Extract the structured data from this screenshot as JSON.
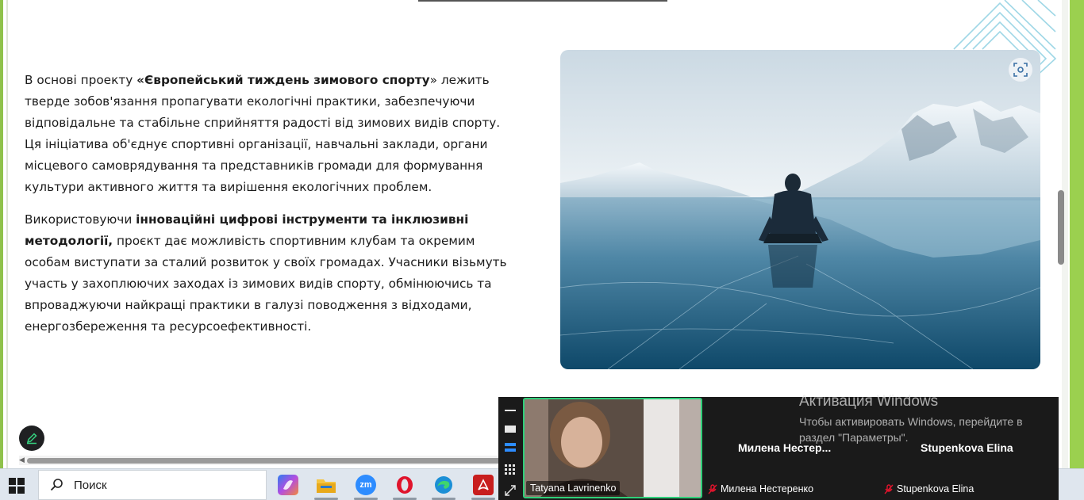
{
  "article": {
    "p1_pre": "В основі проекту ",
    "p1_bold": "«Європейський тиждень зимового спорту",
    "p1_post": "» лежить тверде зобов'язання пропагувати екологічні практики, забезпечуючи відповідальне та стабільне сприйняття радості від зимових видів спорту. Ця ініціатива об'єднує спортивні організації, навчальні заклади, органи місцевого самоврядування та представників громади для формування культури активного життя та вирішення екологічних проблем.",
    "p2_pre": "Використовуючи ",
    "p2_bold": "інноваційні цифрові інструменти та інклюзивні методології,",
    "p2_post": " проєкт дає можливість спортивним клубам та окремим особам виступати за сталий розвиток у своїх громадах. Учасники візьмуть участь у захоплюючих заходах із зимових видів спорту, обмінюючись та впроваджуючи найкращі практики в галузі поводження з відходами, енергозбереження та ресурсоефективності."
  },
  "icons": {
    "photo_zoom": "zoom-focus-icon",
    "edit": "pencil-icon"
  },
  "windows_activation": {
    "title": "Активация Windows",
    "body": "Чтобы активировать Windows, перейдите в раздел \"Параметры\"."
  },
  "zoom_meeting": {
    "participants": [
      {
        "name": "Tatyana Lavrinenko",
        "video": true,
        "muted": false
      },
      {
        "name": "Милена Нестеренко",
        "display_big": "Милена  Нестер...",
        "video": false,
        "muted": true
      },
      {
        "name": "Stupenkova Elina",
        "display_big": "Stupenkova Elina",
        "video": false,
        "muted": true
      }
    ]
  },
  "taskbar": {
    "search_placeholder": "Поиск",
    "apps": [
      {
        "name": "copilot-icon"
      },
      {
        "name": "file-explorer-icon"
      },
      {
        "name": "zoom-icon",
        "label": "zm"
      },
      {
        "name": "opera-icon"
      },
      {
        "name": "edge-icon"
      },
      {
        "name": "acrobat-icon"
      }
    ]
  },
  "colors": {
    "accent_green": "#9bd04f",
    "zoom_active_border": "#2fd07a",
    "zoom_blue": "#2d8cff",
    "opera_red": "#e0142c"
  }
}
